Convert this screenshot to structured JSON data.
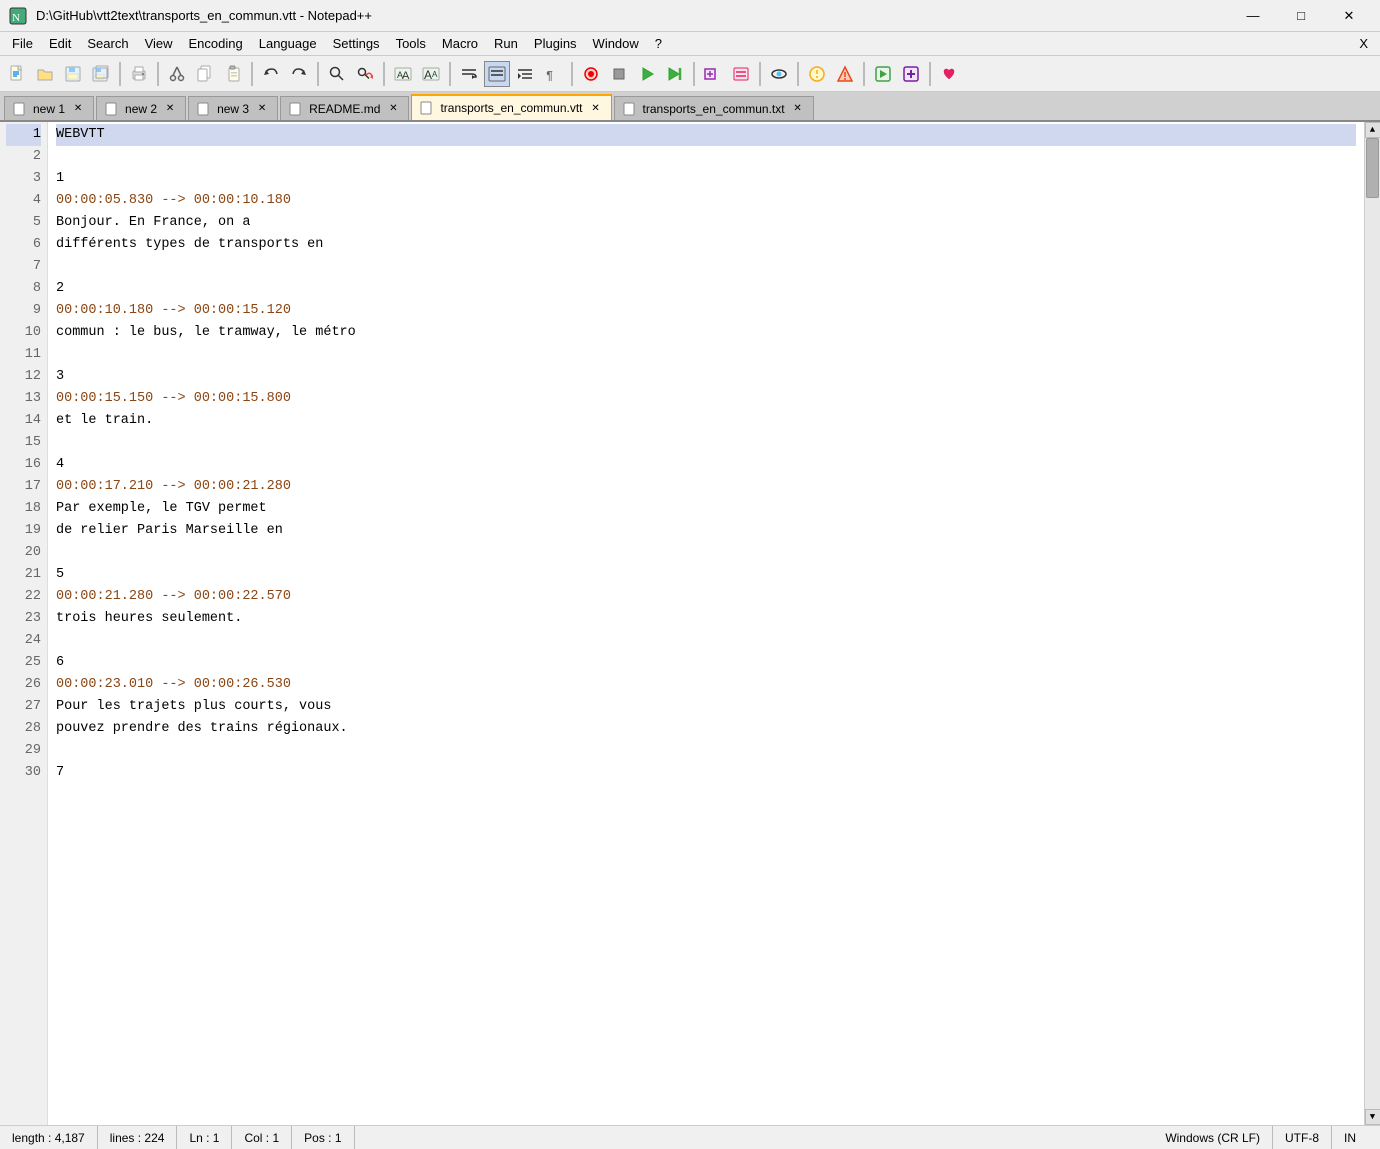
{
  "titlebar": {
    "title": "D:\\GitHub\\vtt2text\\transports_en_commun.vtt - Notepad++",
    "minimize": "—",
    "maximize": "□",
    "close": "✕"
  },
  "menubar": {
    "items": [
      "File",
      "Edit",
      "Search",
      "View",
      "Encoding",
      "Language",
      "Settings",
      "Tools",
      "Macro",
      "Run",
      "Plugins",
      "Window",
      "?"
    ],
    "right_label": "X"
  },
  "tabs": [
    {
      "label": "new 1",
      "active": false
    },
    {
      "label": "new 2",
      "active": false
    },
    {
      "label": "new 3",
      "active": false
    },
    {
      "label": "README.md",
      "active": false
    },
    {
      "label": "transports_en_commun.vtt",
      "active": true,
      "highlight": true
    },
    {
      "label": "transports_en_commun.txt",
      "active": false
    }
  ],
  "code_lines": [
    {
      "num": 1,
      "text": "WEBVTT",
      "active": true
    },
    {
      "num": 2,
      "text": ""
    },
    {
      "num": 3,
      "text": "1"
    },
    {
      "num": 4,
      "text": "00:00:05.830 --> 00:00:10.180",
      "is_timestamp": true
    },
    {
      "num": 5,
      "text": "Bonjour. En France, on a"
    },
    {
      "num": 6,
      "text": "différents types de transports en"
    },
    {
      "num": 7,
      "text": ""
    },
    {
      "num": 8,
      "text": "2"
    },
    {
      "num": 9,
      "text": "00:00:10.180 --> 00:00:15.120",
      "is_timestamp": true
    },
    {
      "num": 10,
      "text": "commun : le bus, le tramway, le métro"
    },
    {
      "num": 11,
      "text": ""
    },
    {
      "num": 12,
      "text": "3"
    },
    {
      "num": 13,
      "text": "00:00:15.150 --> 00:00:15.800",
      "is_timestamp": true
    },
    {
      "num": 14,
      "text": "et le train."
    },
    {
      "num": 15,
      "text": ""
    },
    {
      "num": 16,
      "text": "4"
    },
    {
      "num": 17,
      "text": "00:00:17.210 --> 00:00:21.280",
      "is_timestamp": true
    },
    {
      "num": 18,
      "text": "Par exemple, le TGV permet"
    },
    {
      "num": 19,
      "text": "de relier Paris Marseille en"
    },
    {
      "num": 20,
      "text": ""
    },
    {
      "num": 21,
      "text": "5"
    },
    {
      "num": 22,
      "text": "00:00:21.280 --> 00:00:22.570",
      "is_timestamp": true
    },
    {
      "num": 23,
      "text": "trois heures seulement."
    },
    {
      "num": 24,
      "text": ""
    },
    {
      "num": 25,
      "text": "6"
    },
    {
      "num": 26,
      "text": "00:00:23.010 --> 00:00:26.530",
      "is_timestamp": true
    },
    {
      "num": 27,
      "text": "Pour les trajets plus courts, vous"
    },
    {
      "num": 28,
      "text": "pouvez prendre des trains régionaux."
    },
    {
      "num": 29,
      "text": ""
    },
    {
      "num": 30,
      "text": "7"
    }
  ],
  "statusbar": {
    "length": "length : 4,187",
    "lines": "lines : 224",
    "ln": "Ln : 1",
    "col": "Col : 1",
    "pos": "Pos : 1",
    "eol": "Windows (CR LF)",
    "encoding": "UTF-8",
    "ins": "IN"
  }
}
